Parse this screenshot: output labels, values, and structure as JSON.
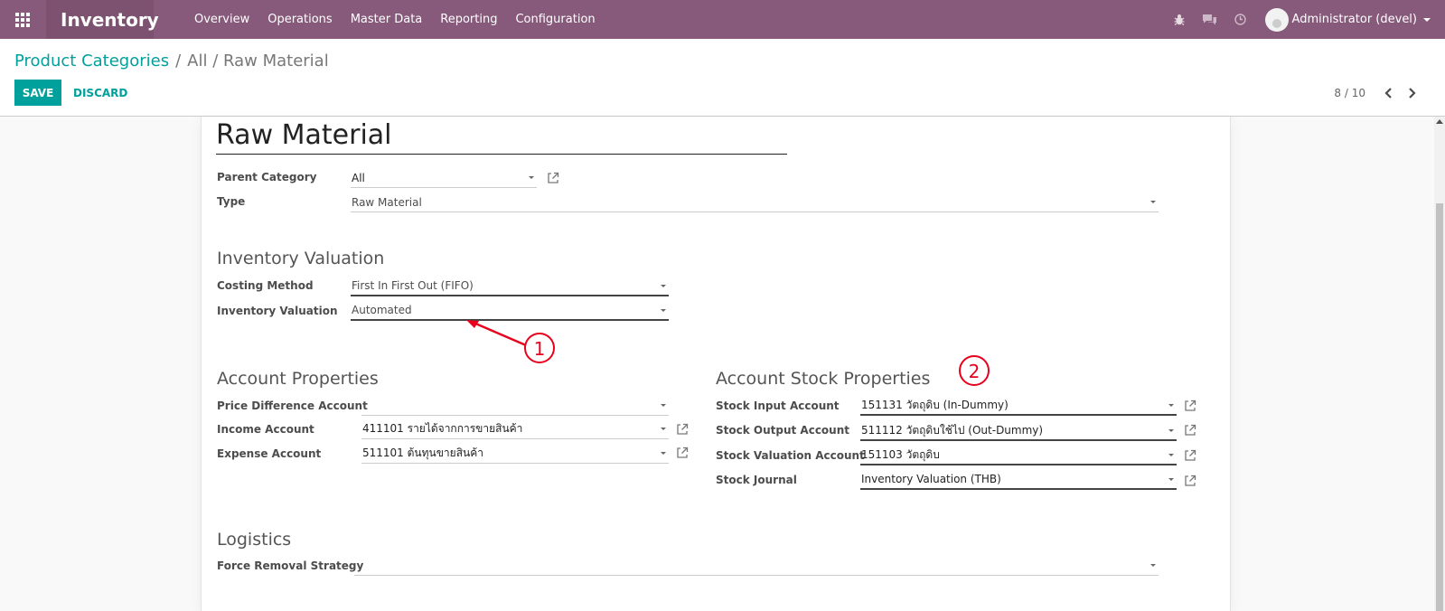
{
  "app": {
    "title": "Inventory"
  },
  "nav": {
    "menu": [
      "Overview",
      "Operations",
      "Master Data",
      "Reporting",
      "Configuration"
    ],
    "user": "Administrator (devel)"
  },
  "breadcrumb": {
    "parent": "Product Categories",
    "separator": "/",
    "current": "All / Raw Material"
  },
  "actions": {
    "save": "SAVE",
    "discard": "DISCARD"
  },
  "pager": {
    "value": "8 / 10"
  },
  "form": {
    "name": "Raw Material",
    "parent_category": {
      "label": "Parent Category",
      "value": "All"
    },
    "type": {
      "label": "Type",
      "value": "Raw Material"
    },
    "inventory_valuation_section": "Inventory Valuation",
    "costing_method": {
      "label": "Costing Method",
      "value": "First In First Out (FIFO)"
    },
    "inventory_valuation": {
      "label": "Inventory Valuation",
      "value": "Automated"
    },
    "account_properties_section": "Account Properties",
    "price_difference_account": {
      "label": "Price Difference Account",
      "value": ""
    },
    "income_account": {
      "label": "Income Account",
      "value": "411101 รายได้จากการขายสินค้า"
    },
    "expense_account": {
      "label": "Expense Account",
      "value": "511101 ต้นทุนขายสินค้า"
    },
    "account_stock_section": "Account Stock Properties",
    "stock_input_account": {
      "label": "Stock Input Account",
      "value": "151131 วัตถุดิบ (In-Dummy)"
    },
    "stock_output_account": {
      "label": "Stock Output Account",
      "value": "511112 วัตถุดิบใช้ไป (Out-Dummy)"
    },
    "stock_valuation_account": {
      "label": "Stock Valuation Account",
      "value": "151103 วัตถุดิบ"
    },
    "stock_journal": {
      "label": "Stock Journal",
      "value": "Inventory Valuation (THB)"
    },
    "logistics_section": "Logistics",
    "force_removal_strategy": {
      "label": "Force Removal Strategy",
      "value": ""
    }
  },
  "annotations": {
    "marker_1": "1",
    "marker_2": "2",
    "color": "#e8001c"
  },
  "colors": {
    "navbar": "#875a7b",
    "brand": "#7c5270",
    "accent": "#00a09d"
  }
}
